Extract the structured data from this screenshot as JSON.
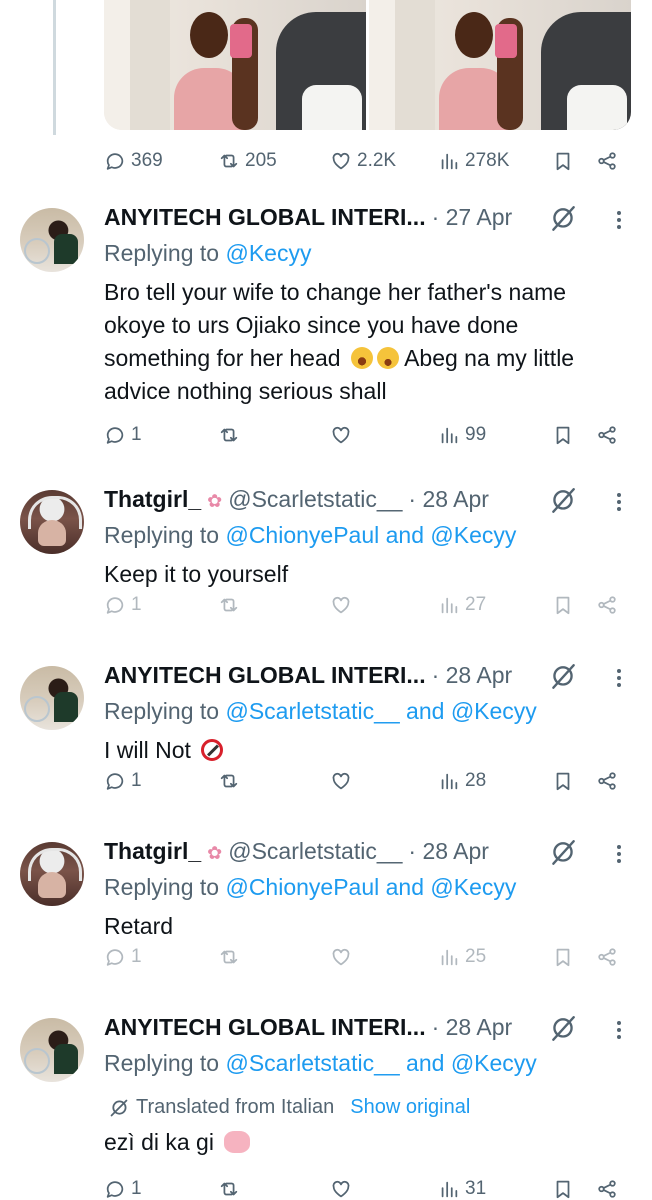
{
  "top_post": {
    "stats": {
      "replies": "369",
      "reposts": "205",
      "likes": "2.2K",
      "views": "278K"
    }
  },
  "replies": [
    {
      "author_name": "ANYITECH GLOBAL INTERI...",
      "handle": "",
      "date": "· 27 Apr",
      "replying_label": "Replying to",
      "replying_to": "@Kecyy",
      "text_lines": [
        "Bro tell your wife to change her father's name",
        "okoye to urs Ojiako since you have done",
        "something for her head",
        "Abeg na my little",
        "advice nothing serious shall"
      ],
      "stats": {
        "replies": "1",
        "reposts": "",
        "likes": "",
        "views": "99"
      },
      "faded": false
    },
    {
      "author_name": "Thatgirl_",
      "handle": "@Scarletstatic__",
      "date": "· 28 Apr",
      "replying_label": "Replying to",
      "replying_to": "@ChionyePaul and @Kecyy",
      "text_lines": [
        "Keep it to yourself"
      ],
      "stats": {
        "replies": "1",
        "reposts": "",
        "likes": "",
        "views": "27"
      },
      "faded": true
    },
    {
      "author_name": "ANYITECH GLOBAL INTERI...",
      "handle": "",
      "date": "· 28 Apr",
      "replying_label": "Replying to",
      "replying_to": "@Scarletstatic__ and @Kecyy",
      "text_lines": [
        "I will Not"
      ],
      "stats": {
        "replies": "1",
        "reposts": "",
        "likes": "",
        "views": "28"
      },
      "faded": false
    },
    {
      "author_name": "Thatgirl_",
      "handle": "@Scarletstatic__",
      "date": "· 28 Apr",
      "replying_label": "Replying to",
      "replying_to": "@ChionyePaul and @Kecyy",
      "text_lines": [
        "Retard"
      ],
      "stats": {
        "replies": "1",
        "reposts": "",
        "likes": "",
        "views": "25"
      },
      "faded": true
    },
    {
      "author_name": "ANYITECH GLOBAL INTERI...",
      "handle": "",
      "date": "· 28 Apr",
      "replying_label": "Replying to",
      "replying_to": "@Scarletstatic__ and @Kecyy",
      "translated_label": "Translated from Italian",
      "show_original_label": "Show original",
      "text_lines": [
        "ezì di ka gi"
      ],
      "stats": {
        "replies": "1",
        "reposts": "",
        "likes": "",
        "views": "31"
      },
      "faded": false
    }
  ],
  "colors": {
    "link": "#1d9bf0",
    "muted": "#536471",
    "text": "#0f1419",
    "thread_line": "#cfd9de"
  },
  "icons": [
    "reply-icon",
    "repost-icon",
    "like-icon",
    "views-icon",
    "bookmark-icon",
    "share-icon",
    "grok-icon",
    "more-icon",
    "translate-icon"
  ]
}
